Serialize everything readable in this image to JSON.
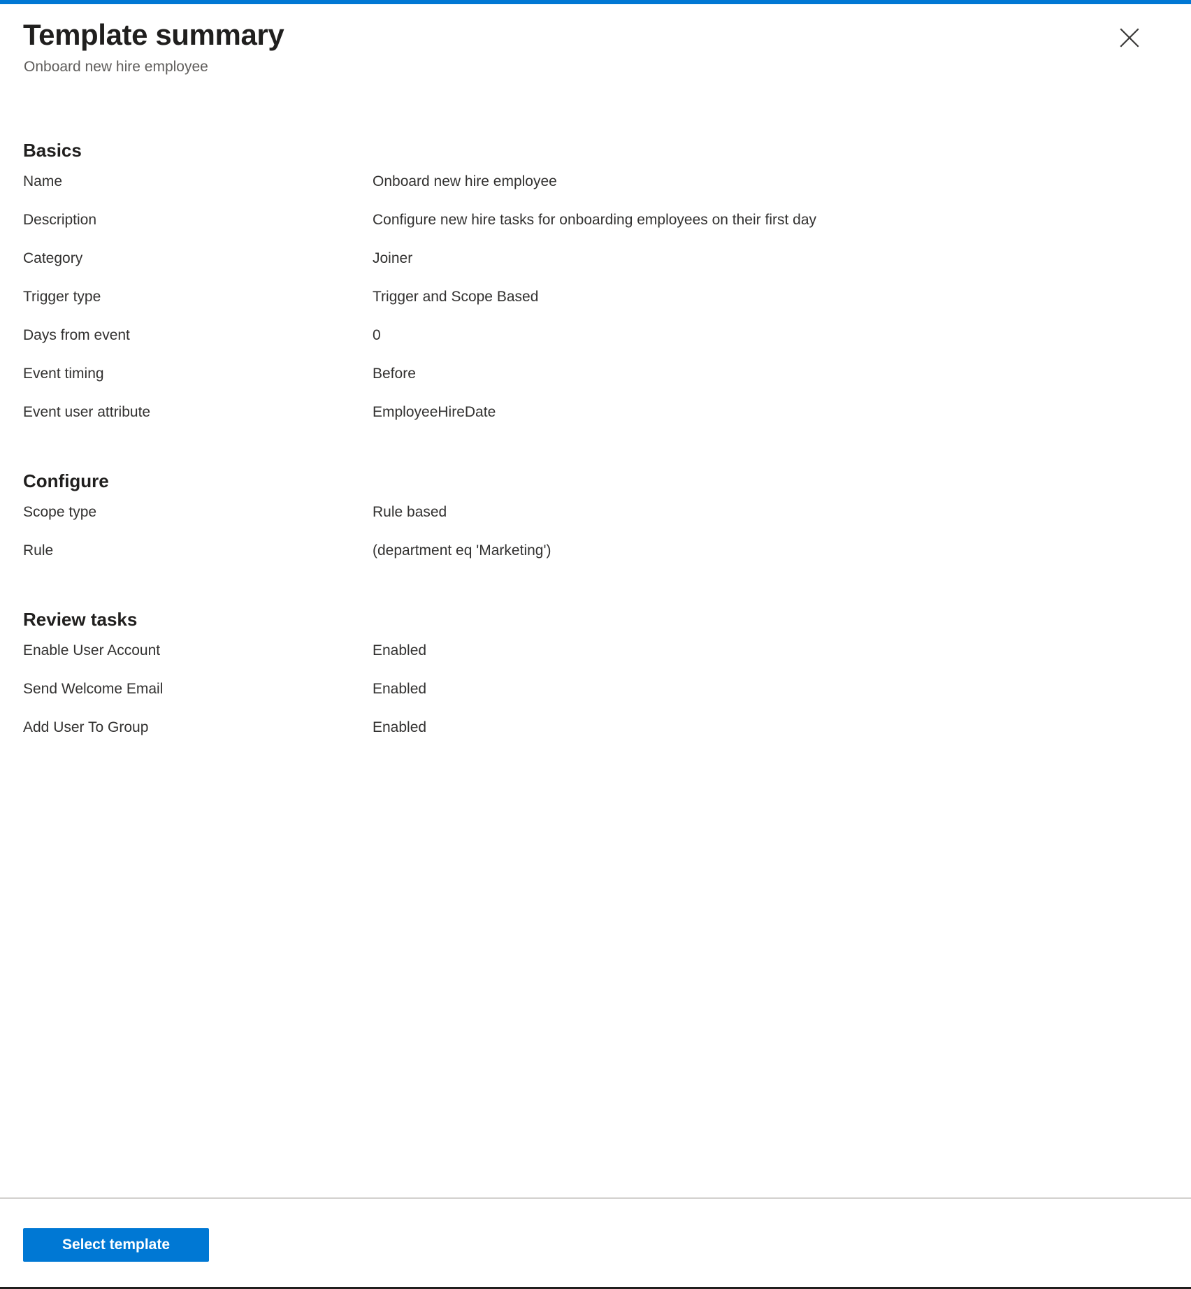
{
  "header": {
    "title": "Template summary",
    "subtitle": "Onboard new hire employee",
    "close_icon": "close-icon"
  },
  "sections": [
    {
      "heading": "Basics",
      "rows": [
        {
          "label": "Name",
          "value": "Onboard new hire employee"
        },
        {
          "label": "Description",
          "value": "Configure new hire tasks for onboarding employees on their first day"
        },
        {
          "label": "Category",
          "value": "Joiner"
        },
        {
          "label": "Trigger type",
          "value": "Trigger and Scope Based"
        },
        {
          "label": "Days from event",
          "value": "0"
        },
        {
          "label": "Event timing",
          "value": "Before"
        },
        {
          "label": "Event user attribute",
          "value": "EmployeeHireDate"
        }
      ]
    },
    {
      "heading": "Configure",
      "rows": [
        {
          "label": "Scope type",
          "value": "Rule based"
        },
        {
          "label": "Rule",
          "value": "(department eq 'Marketing')"
        }
      ]
    },
    {
      "heading": "Review tasks",
      "rows": [
        {
          "label": "Enable User Account",
          "value": "Enabled"
        },
        {
          "label": "Send Welcome Email",
          "value": "Enabled"
        },
        {
          "label": "Add User To Group",
          "value": "Enabled"
        }
      ]
    }
  ],
  "footer": {
    "select_template_label": "Select template"
  },
  "colors": {
    "accent": "#0078d4",
    "title_text": "#201f1e",
    "body_text": "#323130",
    "subtitle_text": "#605e5c",
    "divider": "#d2d0ce",
    "bottom_border": "#201f1e"
  }
}
